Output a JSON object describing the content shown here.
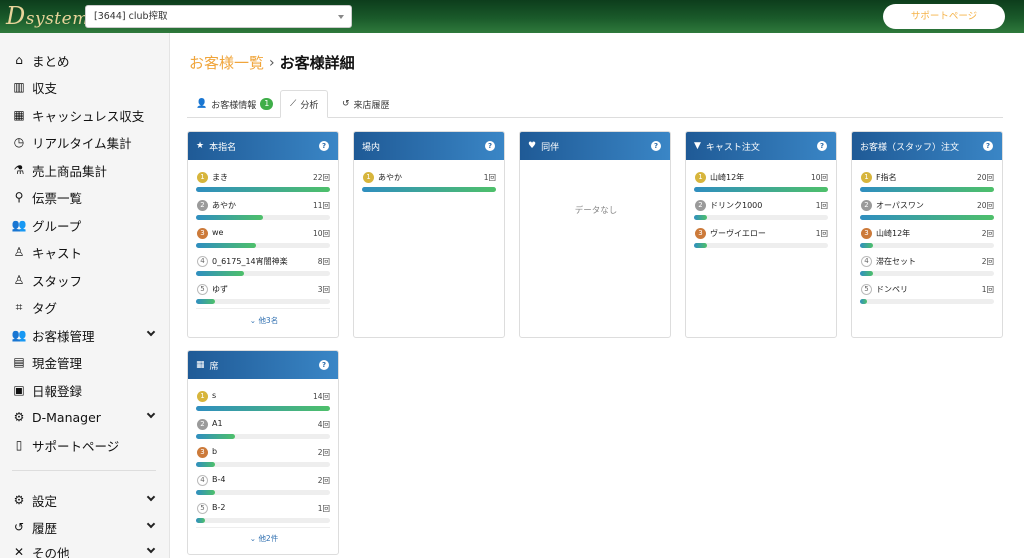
{
  "header": {
    "logo_text": "Dsystem",
    "store_select": "[3644] club搾取",
    "support_button": "サポートページ"
  },
  "sidebar": {
    "items": [
      {
        "label": "まとめ",
        "icon": "home-icon"
      },
      {
        "label": "収支",
        "icon": "bar-chart-icon"
      },
      {
        "label": "キャッシュレス収支",
        "icon": "building-icon"
      },
      {
        "label": "リアルタイム集計",
        "icon": "clock-icon"
      },
      {
        "label": "売上商品集計",
        "icon": "flask-icon"
      },
      {
        "label": "伝票一覧",
        "icon": "search-icon"
      },
      {
        "label": "グループ",
        "icon": "users-icon"
      },
      {
        "label": "キャスト",
        "icon": "person-icon"
      },
      {
        "label": "スタッフ",
        "icon": "person-icon"
      },
      {
        "label": "タグ",
        "icon": "tags-icon"
      },
      {
        "label": "お客様管理",
        "icon": "users-icon",
        "expandable": true
      },
      {
        "label": "現金管理",
        "icon": "calculator-icon"
      },
      {
        "label": "日報登録",
        "icon": "calendar-icon"
      },
      {
        "label": "D-Manager",
        "icon": "gear-icon",
        "expandable": true
      },
      {
        "label": "サポートページ",
        "icon": "file-icon"
      }
    ],
    "bottom_items": [
      {
        "label": "設定",
        "icon": "gears-icon",
        "expandable": true
      },
      {
        "label": "履歴",
        "icon": "history-icon",
        "expandable": true
      },
      {
        "label": "その他",
        "icon": "tools-icon",
        "expandable": true
      }
    ]
  },
  "breadcrumb": {
    "parent": "お客様一覧",
    "current": "お客様詳細"
  },
  "tabs": [
    {
      "label": "お客様情報",
      "badge": "1"
    },
    {
      "label": "分析"
    },
    {
      "label": "来店履歴"
    }
  ],
  "cards": {
    "honshimei": {
      "title": "本指名",
      "rows": [
        {
          "rank": "1",
          "name": "まき",
          "count": "22回",
          "ratio": 1.0
        },
        {
          "rank": "2",
          "name": "あやか",
          "count": "11回",
          "ratio": 0.5
        },
        {
          "rank": "3",
          "name": "we",
          "count": "10回",
          "ratio": 0.45
        },
        {
          "rank": "4",
          "name": "0_6175_14宵闇神楽",
          "count": "8回",
          "ratio": 0.36
        },
        {
          "rank": "5",
          "name": "ゆず",
          "count": "3回",
          "ratio": 0.14
        }
      ],
      "more": "他3名"
    },
    "jonai": {
      "title": "場内",
      "rows": [
        {
          "rank": "1",
          "name": "あやか",
          "count": "1回",
          "ratio": 1.0
        }
      ]
    },
    "douhan": {
      "title": "同伴",
      "empty": "データなし"
    },
    "cast_order": {
      "title": "キャスト注文",
      "rows": [
        {
          "rank": "1",
          "name": "山崎12年",
          "count": "10回",
          "ratio": 1.0
        },
        {
          "rank": "2",
          "name": "ドリンク1000",
          "count": "1回",
          "ratio": 0.1
        },
        {
          "rank": "3",
          "name": "ヴーヴイエロー",
          "count": "1回",
          "ratio": 0.1
        }
      ]
    },
    "guest_order": {
      "title": "お客様（スタッフ）注文",
      "rows": [
        {
          "rank": "1",
          "name": "F指名",
          "count": "20回",
          "ratio": 1.0
        },
        {
          "rank": "2",
          "name": "オーパスワン",
          "count": "20回",
          "ratio": 1.0
        },
        {
          "rank": "3",
          "name": "山崎12年",
          "count": "2回",
          "ratio": 0.1
        },
        {
          "rank": "4",
          "name": "滞在セット",
          "count": "2回",
          "ratio": 0.1
        },
        {
          "rank": "5",
          "name": "ドンペリ",
          "count": "1回",
          "ratio": 0.05
        }
      ]
    },
    "seat": {
      "title": "席",
      "rows": [
        {
          "rank": "1",
          "name": "s",
          "count": "14回",
          "ratio": 1.0
        },
        {
          "rank": "2",
          "name": "A1",
          "count": "4回",
          "ratio": 0.29
        },
        {
          "rank": "3",
          "name": "b",
          "count": "2回",
          "ratio": 0.14
        },
        {
          "rank": "4",
          "name": "B-4",
          "count": "2回",
          "ratio": 0.14
        },
        {
          "rank": "5",
          "name": "B-2",
          "count": "1回",
          "ratio": 0.07
        }
      ],
      "more": "他2件"
    }
  },
  "colors": {
    "header_green": "#1a5a2a",
    "card_header_blue": "#2f72b2",
    "accent_orange": "#f0a53b",
    "badge_green": "#3fae49"
  }
}
